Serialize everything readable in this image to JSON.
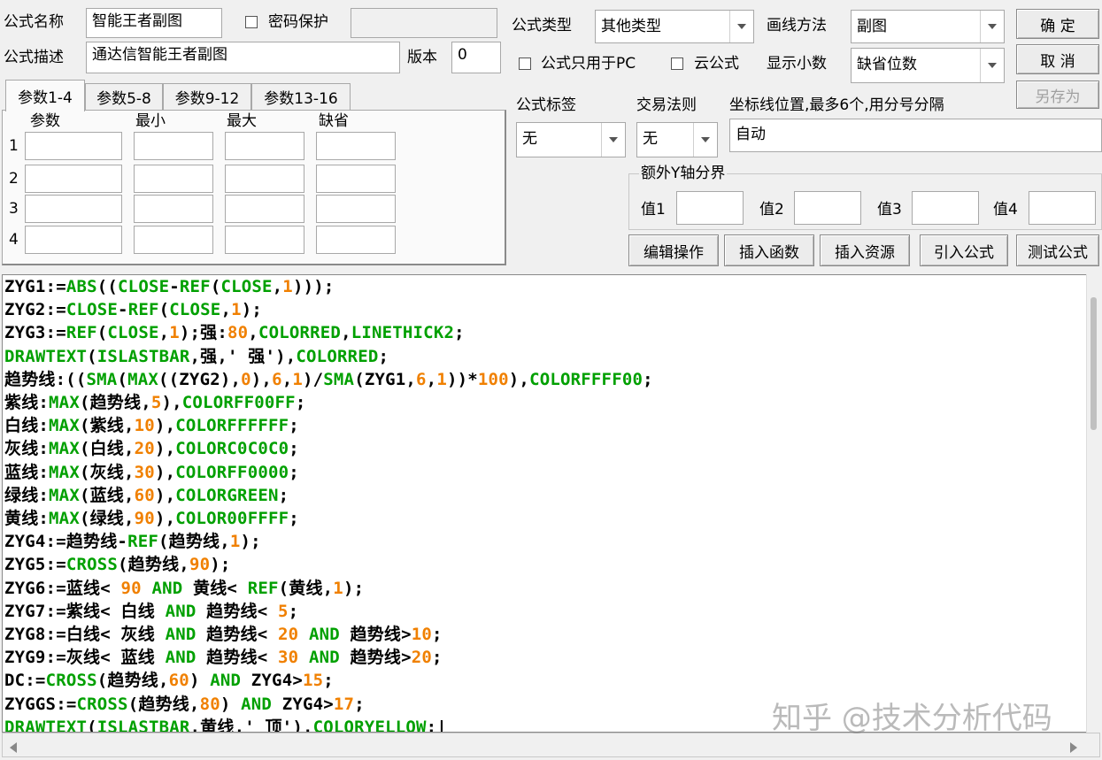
{
  "header": {
    "name_label": "公式名称",
    "name_value": "智能王者副图",
    "password_label": "密码保护",
    "desc_label": "公式描述",
    "desc_value": "通达信智能王者副图",
    "version_label": "版本",
    "version_value": "0"
  },
  "formula_type": {
    "label": "公式类型",
    "value": "其他类型"
  },
  "draw_method": {
    "label": "画线方法",
    "value": "副图"
  },
  "options": {
    "pc_only_label": "公式只用于PC",
    "cloud_label": "云公式"
  },
  "decimals": {
    "label": "显示小数",
    "value": "缺省位数"
  },
  "buttons": {
    "ok": "确  定",
    "cancel": "取  消",
    "save_as": "另存为"
  },
  "tabs": [
    "参数1-4",
    "参数5-8",
    "参数9-12",
    "参数13-16"
  ],
  "param_headers": [
    "参数",
    "最小",
    "最大",
    "缺省"
  ],
  "param_rows": [
    "1",
    "2",
    "3",
    "4"
  ],
  "tag": {
    "label": "公式标签",
    "value": "无"
  },
  "trade_rule": {
    "label": "交易法则",
    "value": "无"
  },
  "axis": {
    "label": "坐标线位置,最多6个,用分号分隔",
    "value": "自动"
  },
  "extra_y": {
    "label": "额外Y轴分界",
    "values": [
      "值1",
      "值2",
      "值3",
      "值4"
    ]
  },
  "actions": [
    "编辑操作",
    "插入函数",
    "插入资源",
    "引入公式",
    "测试公式"
  ],
  "watermark": "知乎 @技术分析代码",
  "code_lines": [
    [
      [
        "t",
        "ZYG1:="
      ],
      [
        "k",
        "ABS"
      ],
      [
        "t",
        "(("
      ],
      [
        "k",
        "CLOSE"
      ],
      [
        "t",
        "-"
      ],
      [
        "k",
        "REF"
      ],
      [
        "t",
        "("
      ],
      [
        "k",
        "CLOSE"
      ],
      [
        "t",
        ","
      ],
      [
        "n",
        "1"
      ],
      [
        "t",
        ")));"
      ]
    ],
    [
      [
        "t",
        "ZYG2:="
      ],
      [
        "k",
        "CLOSE"
      ],
      [
        "t",
        "-"
      ],
      [
        "k",
        "REF"
      ],
      [
        "t",
        "("
      ],
      [
        "k",
        "CLOSE"
      ],
      [
        "t",
        ","
      ],
      [
        "n",
        "1"
      ],
      [
        "t",
        ");"
      ]
    ],
    [
      [
        "t",
        "ZYG3:="
      ],
      [
        "k",
        "REF"
      ],
      [
        "t",
        "("
      ],
      [
        "k",
        "CLOSE"
      ],
      [
        "t",
        ","
      ],
      [
        "n",
        "1"
      ],
      [
        "t",
        ");强:"
      ],
      [
        "n",
        "80"
      ],
      [
        "t",
        ","
      ],
      [
        "k",
        "COLORRED"
      ],
      [
        "t",
        ","
      ],
      [
        "k",
        "LINETHICK2"
      ],
      [
        "t",
        ";"
      ]
    ],
    [
      [
        "k",
        "DRAWTEXT"
      ],
      [
        "t",
        "("
      ],
      [
        "k",
        "ISLASTBAR"
      ],
      [
        "t",
        ",强,' 强'),"
      ],
      [
        "k",
        "COLORRED"
      ],
      [
        "t",
        ";"
      ]
    ],
    [
      [
        "t",
        "趋势线:(("
      ],
      [
        "k",
        "SMA"
      ],
      [
        "t",
        "("
      ],
      [
        "k",
        "MAX"
      ],
      [
        "t",
        "((ZYG2),"
      ],
      [
        "n",
        "0"
      ],
      [
        "t",
        "),"
      ],
      [
        "n",
        "6"
      ],
      [
        "t",
        ","
      ],
      [
        "n",
        "1"
      ],
      [
        "t",
        ")/"
      ],
      [
        "k",
        "SMA"
      ],
      [
        "t",
        "(ZYG1,"
      ],
      [
        "n",
        "6"
      ],
      [
        "t",
        ","
      ],
      [
        "n",
        "1"
      ],
      [
        "t",
        "))*"
      ],
      [
        "n",
        "100"
      ],
      [
        "t",
        "),"
      ],
      [
        "k",
        "COLORFFFF00"
      ],
      [
        "t",
        ";"
      ]
    ],
    [
      [
        "t",
        "紫线:"
      ],
      [
        "k",
        "MAX"
      ],
      [
        "t",
        "(趋势线,"
      ],
      [
        "n",
        "5"
      ],
      [
        "t",
        "),"
      ],
      [
        "k",
        "COLORFF00FF"
      ],
      [
        "t",
        ";"
      ]
    ],
    [
      [
        "t",
        "白线:"
      ],
      [
        "k",
        "MAX"
      ],
      [
        "t",
        "(紫线,"
      ],
      [
        "n",
        "10"
      ],
      [
        "t",
        "),"
      ],
      [
        "k",
        "COLORFFFFFF"
      ],
      [
        "t",
        ";"
      ]
    ],
    [
      [
        "t",
        "灰线:"
      ],
      [
        "k",
        "MAX"
      ],
      [
        "t",
        "(白线,"
      ],
      [
        "n",
        "20"
      ],
      [
        "t",
        "),"
      ],
      [
        "k",
        "COLORC0C0C0"
      ],
      [
        "t",
        ";"
      ]
    ],
    [
      [
        "t",
        "蓝线:"
      ],
      [
        "k",
        "MAX"
      ],
      [
        "t",
        "(灰线,"
      ],
      [
        "n",
        "30"
      ],
      [
        "t",
        "),"
      ],
      [
        "k",
        "COLORFF0000"
      ],
      [
        "t",
        ";"
      ]
    ],
    [
      [
        "t",
        "绿线:"
      ],
      [
        "k",
        "MAX"
      ],
      [
        "t",
        "(蓝线,"
      ],
      [
        "n",
        "60"
      ],
      [
        "t",
        "),"
      ],
      [
        "k",
        "COLORGREEN"
      ],
      [
        "t",
        ";"
      ]
    ],
    [
      [
        "t",
        "黄线:"
      ],
      [
        "k",
        "MAX"
      ],
      [
        "t",
        "(绿线,"
      ],
      [
        "n",
        "90"
      ],
      [
        "t",
        "),"
      ],
      [
        "k",
        "COLOR00FFFF"
      ],
      [
        "t",
        ";"
      ]
    ],
    [
      [
        "t",
        "ZYG4:=趋势线-"
      ],
      [
        "k",
        "REF"
      ],
      [
        "t",
        "(趋势线,"
      ],
      [
        "n",
        "1"
      ],
      [
        "t",
        ");"
      ]
    ],
    [
      [
        "t",
        "ZYG5:="
      ],
      [
        "k",
        "CROSS"
      ],
      [
        "t",
        "(趋势线,"
      ],
      [
        "n",
        "90"
      ],
      [
        "t",
        ");"
      ]
    ],
    [
      [
        "t",
        "ZYG6:=蓝线< "
      ],
      [
        "n",
        "90"
      ],
      [
        "t",
        " "
      ],
      [
        "k",
        "AND"
      ],
      [
        "t",
        " 黄线< "
      ],
      [
        "k",
        "REF"
      ],
      [
        "t",
        "(黄线,"
      ],
      [
        "n",
        "1"
      ],
      [
        "t",
        ");"
      ]
    ],
    [
      [
        "t",
        "ZYG7:=紫线< 白线 "
      ],
      [
        "k",
        "AND"
      ],
      [
        "t",
        " 趋势线< "
      ],
      [
        "n",
        "5"
      ],
      [
        "t",
        ";"
      ]
    ],
    [
      [
        "t",
        "ZYG8:=白线< 灰线 "
      ],
      [
        "k",
        "AND"
      ],
      [
        "t",
        " 趋势线< "
      ],
      [
        "n",
        "20"
      ],
      [
        "t",
        " "
      ],
      [
        "k",
        "AND"
      ],
      [
        "t",
        " 趋势线>"
      ],
      [
        "n",
        "10"
      ],
      [
        "t",
        ";"
      ]
    ],
    [
      [
        "t",
        "ZYG9:=灰线< 蓝线 "
      ],
      [
        "k",
        "AND"
      ],
      [
        "t",
        " 趋势线< "
      ],
      [
        "n",
        "30"
      ],
      [
        "t",
        " "
      ],
      [
        "k",
        "AND"
      ],
      [
        "t",
        " 趋势线>"
      ],
      [
        "n",
        "20"
      ],
      [
        "t",
        ";"
      ]
    ],
    [
      [
        "t",
        "DC:="
      ],
      [
        "k",
        "CROSS"
      ],
      [
        "t",
        "(趋势线,"
      ],
      [
        "n",
        "60"
      ],
      [
        "t",
        ") "
      ],
      [
        "k",
        "AND"
      ],
      [
        "t",
        " ZYG4>"
      ],
      [
        "n",
        "15"
      ],
      [
        "t",
        ";"
      ]
    ],
    [
      [
        "t",
        "ZYGGS:="
      ],
      [
        "k",
        "CROSS"
      ],
      [
        "t",
        "(趋势线,"
      ],
      [
        "n",
        "80"
      ],
      [
        "t",
        ") "
      ],
      [
        "k",
        "AND"
      ],
      [
        "t",
        " ZYG4>"
      ],
      [
        "n",
        "17"
      ],
      [
        "t",
        ";"
      ]
    ],
    [
      [
        "k",
        "DRAWTEXT"
      ],
      [
        "t",
        "("
      ],
      [
        "k",
        "ISLASTBAR"
      ],
      [
        "t",
        ",黄线,' 顶'),"
      ],
      [
        "k",
        "COLORYELLOW"
      ],
      [
        "t",
        ";|"
      ]
    ]
  ]
}
